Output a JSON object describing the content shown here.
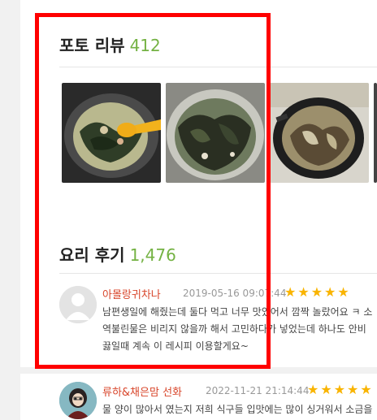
{
  "photo_review": {
    "title": "포토 리뷰",
    "count": "412"
  },
  "cooking_review": {
    "title": "요리 후기",
    "count": "1,476"
  },
  "reviews": [
    {
      "author": "아몰랑귀차나",
      "date": "2019-05-16 09:07:44",
      "rating": "★★★★★",
      "lines": [
        "남편생일에 해줬는데 둘다 먹고 너무 맛있어서 깜짝 놀랐어요 ㅋ 소",
        "역불린물은 비리지 않을까 해서 고민하다가 넣었는데 하나도 안비",
        "끓일때 계속 이 레시피 이용할게요~"
      ]
    },
    {
      "author": "류하&채은맘 선화",
      "date": "2022-11-21 21:14:44",
      "rating": "★★★★★",
      "lines": [
        "물 양이 많아서 였는지 저희 식구들 입맛에는 많이 싱거워서 소금을"
      ]
    }
  ],
  "colors": {
    "accent_count": "#74b243",
    "author": "#d8452a",
    "star": "#f9b400",
    "highlight_box": "#ff0000"
  }
}
